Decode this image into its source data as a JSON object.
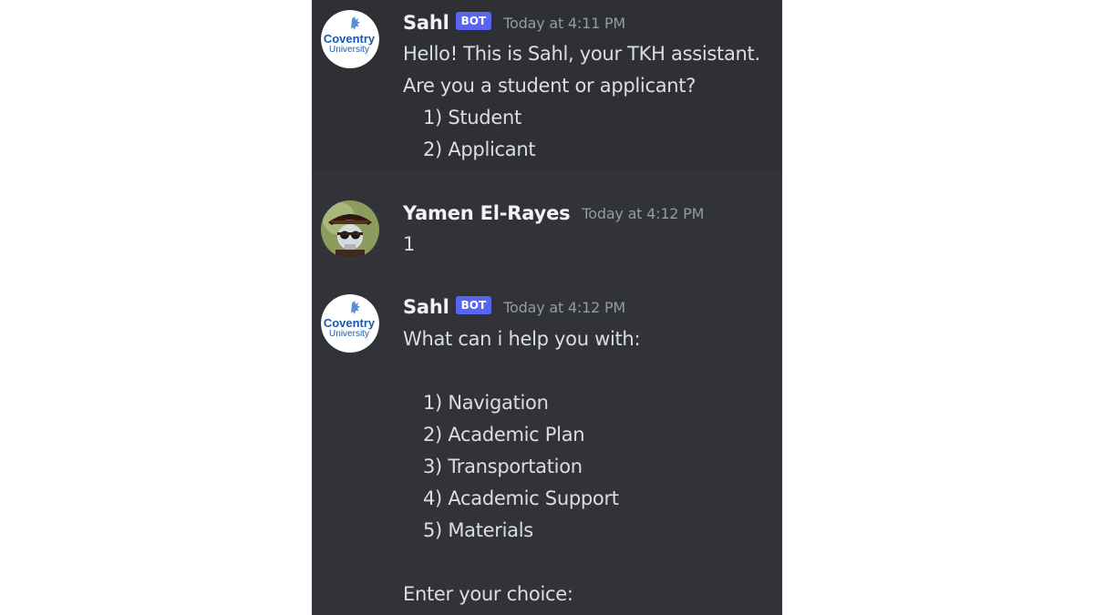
{
  "messages": [
    {
      "author": "Sahl",
      "bot_tag": "BOT",
      "timestamp": "Today at 4:11 PM",
      "avatar": "coventry-university-logo",
      "avatar_text": [
        "Coventry",
        "University"
      ],
      "lines": [
        "Hello! This is Sahl, your TKH assistant.",
        "Are you a student or applicant?",
        "1) Student",
        "2) Applicant"
      ]
    },
    {
      "author": "Yamen El-Rayes",
      "timestamp": "Today at 4:12 PM",
      "avatar": "pirate-skull-avatar",
      "lines": [
        "1"
      ]
    },
    {
      "author": "Sahl",
      "bot_tag": "BOT",
      "timestamp": "Today at 4:12 PM",
      "avatar": "coventry-university-logo",
      "avatar_text": [
        "Coventry",
        "University"
      ],
      "lines": [
        "What can i help you with:",
        "",
        "1) Navigation",
        "2) Academic Plan",
        "3) Transportation",
        "4) Academic Support",
        "5) Materials",
        "",
        "Enter your choice:"
      ]
    }
  ],
  "colors": {
    "background": "#313338",
    "username": "#f2f3f5",
    "text": "#dbdee1",
    "timestamp": "#949ba4",
    "bot_tag": "#5865f2",
    "coventry_blue": "#1c5aa8"
  }
}
